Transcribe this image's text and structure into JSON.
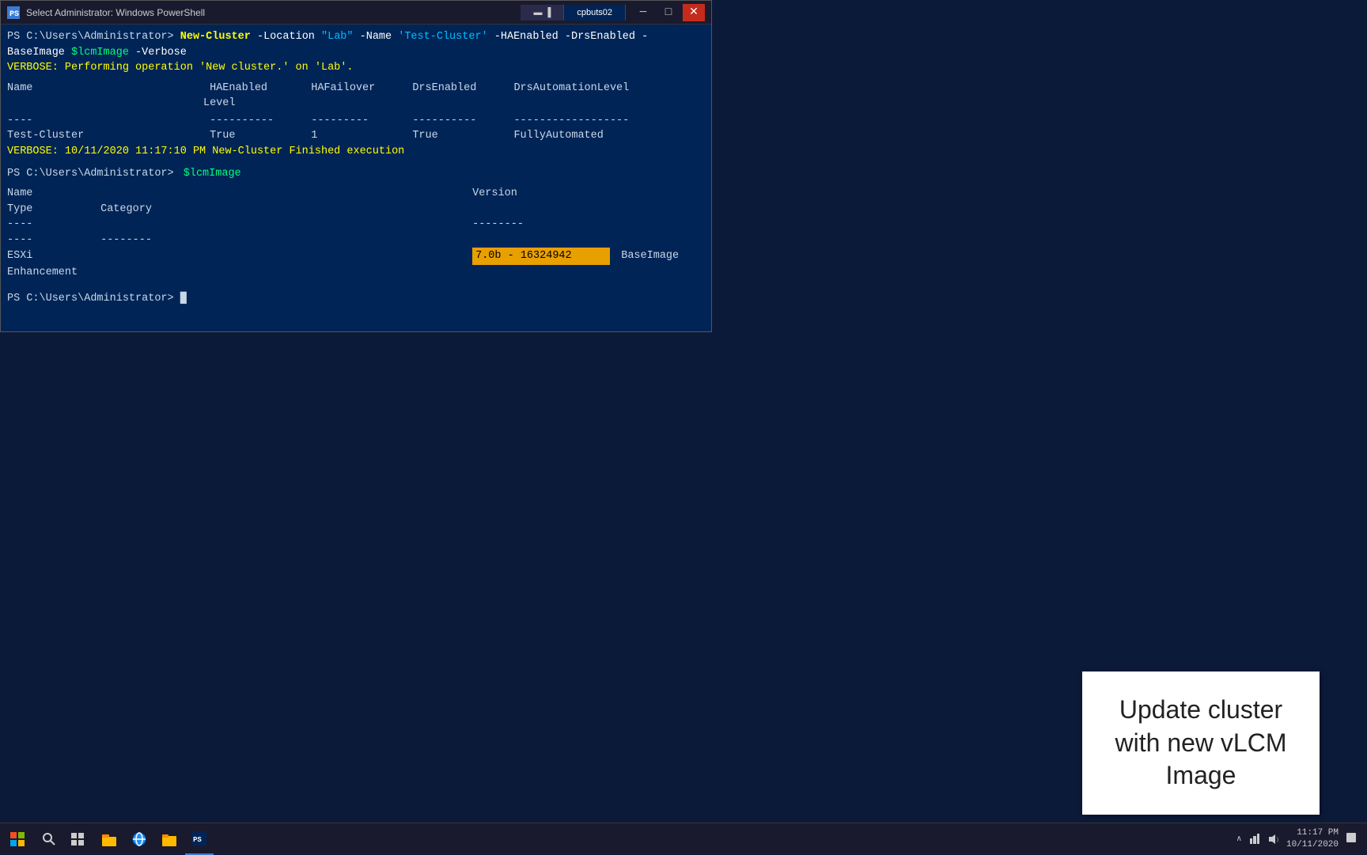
{
  "window": {
    "title": "Select Administrator: Windows PowerShell",
    "tab1_label": "▬ ▐",
    "tab2_label": "cpbuts02",
    "minimize": "─",
    "maximize": "□",
    "close": "✕"
  },
  "terminal": {
    "line1_prompt": "PS C:\\Users\\Administrator>",
    "line1_cmd": "New-Cluster",
    "line1_params": " -Location ",
    "line1_loc": "\"Lab\"",
    "line1_name_param": " -Name ",
    "line1_name_val": "'Test-Cluster'",
    "line1_rest": " -HAEnabled -DrsEnabled -BaseImage ",
    "line1_var": "$lcmImage",
    "line1_verbose": " -Verbose",
    "verbose1": "VERBOSE: Performing operation 'New cluster.' on 'Lab'.",
    "col_name": "Name",
    "col_haenabled": "HAEnabled",
    "col_hafailover": "HAFailover",
    "col_hafailover2": "Level",
    "col_drsenabled": "DrsEnabled",
    "col_drsauto": "DrsAutomationLevel",
    "sep1": "----",
    "sep2": "----------",
    "sep3": "---------",
    "sep4": "----------",
    "sep5": "------------------",
    "row_name": "Test-Cluster",
    "row_ha": "True",
    "row_hafail": "1",
    "row_drs": "True",
    "row_drsauto": "FullyAutomated",
    "verbose2": "VERBOSE: 10/11/2020 11:17:10 PM New-Cluster Finished execution",
    "line2_prompt": "PS C:\\Users\\Administrator>",
    "line2_var": "$lcmImage",
    "col2_name": "Name",
    "col2_version": "Version",
    "col2_type": "Type",
    "col2_category": "Category",
    "sep2_1": "----",
    "sep2_2": "--------",
    "sep2_3": "----",
    "sep2_4": "--------",
    "row2_name": "ESXi",
    "row2_version": "7.0b - 16324942",
    "row2_type": "BaseImage",
    "row2_category": "Enhancement",
    "line3_prompt": "PS C:\\Users\\Administrator>",
    "cursor": "█"
  },
  "annotation": {
    "text": "Update cluster with new vLCM Image"
  },
  "taskbar": {
    "time": "11:17 PM",
    "date": "10/11/2020"
  }
}
